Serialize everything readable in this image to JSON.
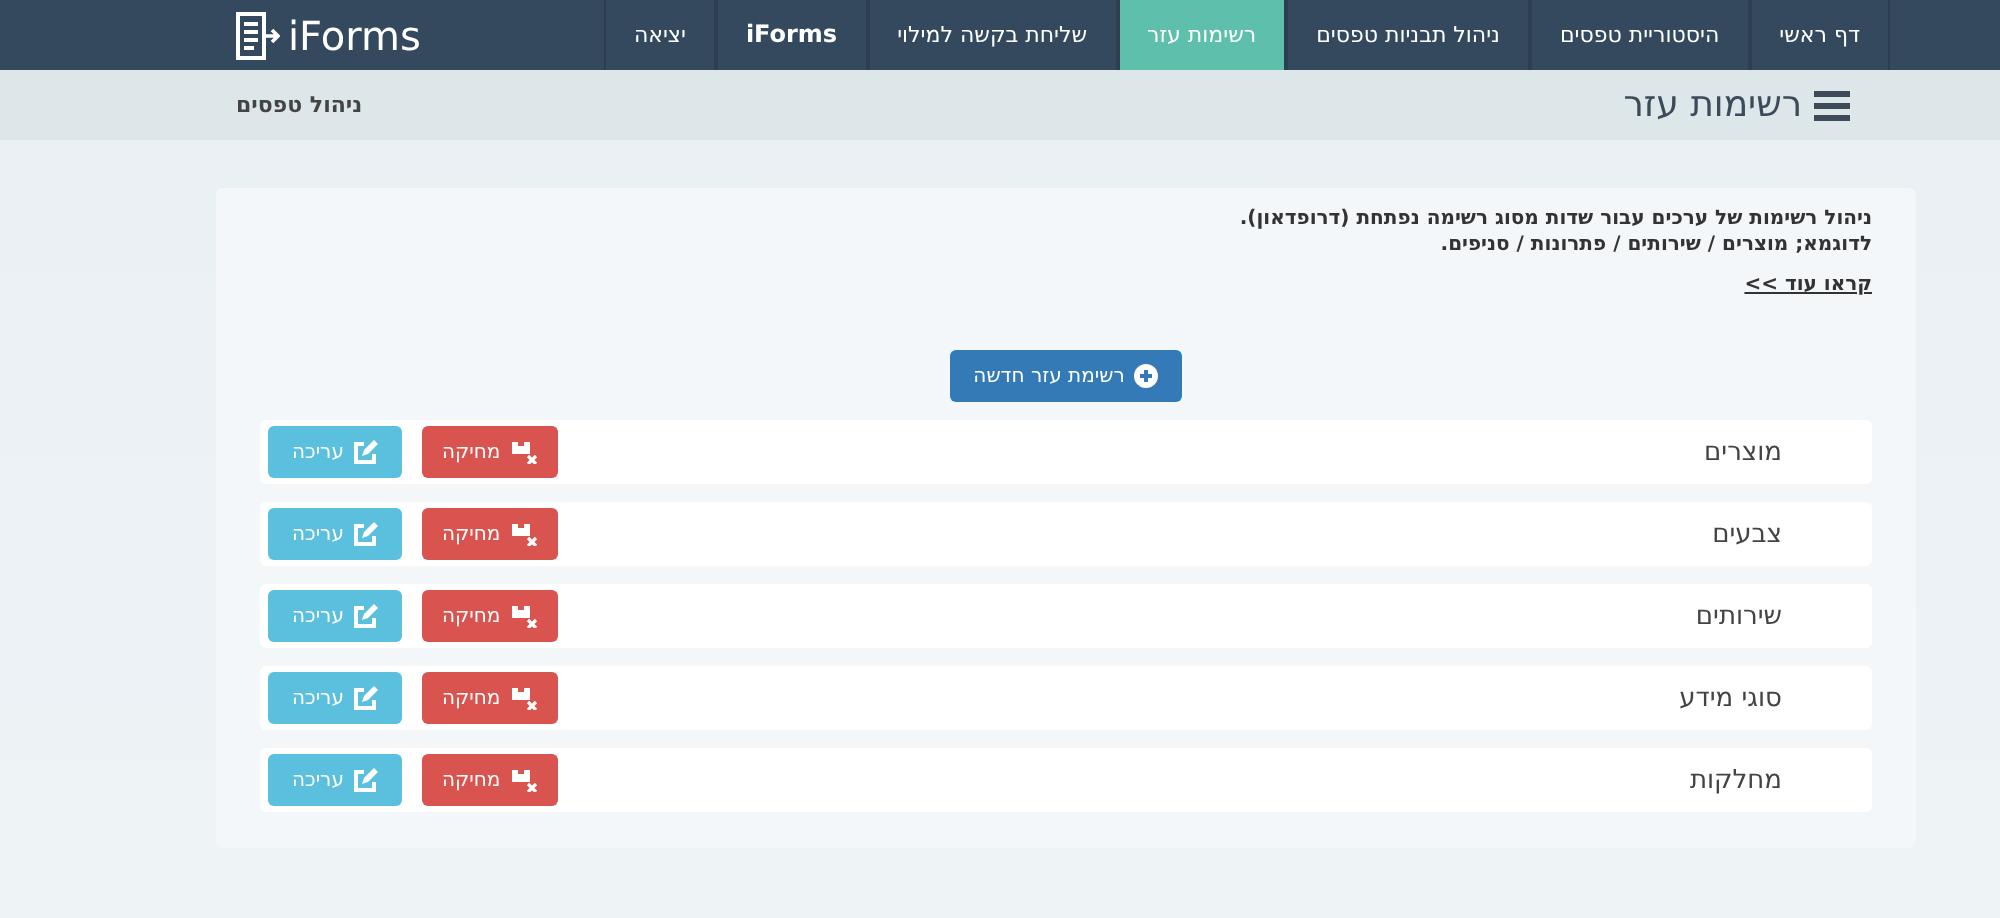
{
  "brand": "iForms",
  "nav": [
    {
      "label": "דף ראשי",
      "selected": false
    },
    {
      "label": "היסטוריית טפסים",
      "selected": false
    },
    {
      "label": "ניהול תבניות טפסים",
      "selected": false
    },
    {
      "label": "רשימות עזר",
      "selected": true
    },
    {
      "label": "שליחת בקשה למילוי",
      "selected": false
    },
    {
      "label": "iForms",
      "selected": false
    },
    {
      "label": "יציאה",
      "selected": false
    }
  ],
  "page_title": "רשימות עזר",
  "breadcrumb": "ניהול טפסים",
  "intro": [
    "ניהול רשימות של ערכים עבור שדות מסוג רשימה נפתחת (דרופדאון).",
    "לדוגמא; מוצרים / שירותים / פתרונות / סניפים."
  ],
  "read_more": "קראו עוד >>",
  "new_button": "רשימת עזר חדשה",
  "lists": [
    {
      "name": "מוצרים",
      "edit": "עריכה",
      "delete": "מחיקה"
    },
    {
      "name": "צבעים",
      "edit": "עריכה",
      "delete": "מחיקה"
    },
    {
      "name": "שירותים",
      "edit": "עריכה",
      "delete": "מחיקה"
    },
    {
      "name": "סוגי מידע",
      "edit": "עריכה",
      "delete": "מחיקה"
    },
    {
      "name": "מחלקות",
      "edit": "עריכה",
      "delete": "מחיקה"
    }
  ]
}
